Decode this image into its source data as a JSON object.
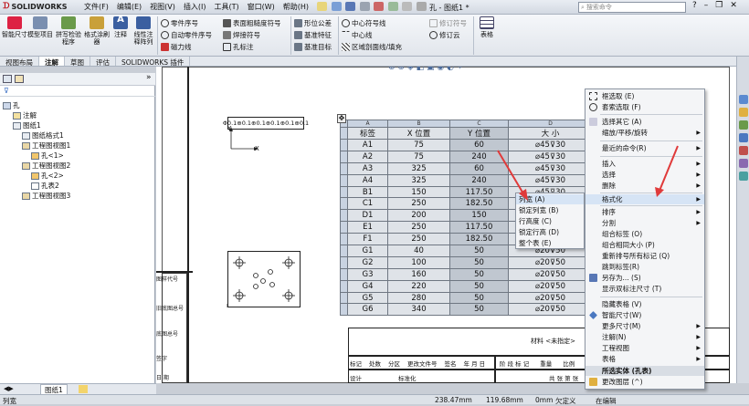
{
  "app": {
    "brand": "SOLIDWORKS",
    "title": "孔 - 图纸1 *",
    "search_placeholder": "搜索命令"
  },
  "menu": [
    "文件(F)",
    "编辑(E)",
    "视图(V)",
    "插入(I)",
    "工具(T)",
    "窗口(W)",
    "帮助(H)"
  ],
  "ribbon": {
    "big": [
      "智能尺寸",
      "模型项目",
      "拼写检验程序",
      "格式涂刷器",
      "注释",
      "线性注释阵列"
    ],
    "small": [
      "零件序号",
      "自动零件序号",
      "磁力线",
      "表面粗糙度符号",
      "焊接符号",
      "孔标注",
      "形位公差",
      "基准特征",
      "基准目标",
      "中心符号线",
      "中心线",
      "区域剖面线/填充",
      "修订符号",
      "修订云"
    ],
    "table": "表格"
  },
  "tabs": [
    "视图布局",
    "注解",
    "草图",
    "评估",
    "SOLIDWORKS 插件"
  ],
  "tree": [
    "孔",
    "注解",
    "图纸1",
    "图纸格式1",
    "工程图视图1",
    "孔<1>",
    "工程图视图2",
    "孔<2>",
    "孔表2",
    "工程图视图3"
  ],
  "sheet_tabs": [
    "图纸1"
  ],
  "drawing": {
    "fcf_top": "Φ0.1⊕0.1⊕0.1⊕0.1⊕0.1⊕0.1",
    "axis_x": "X",
    "axis_y": "Y",
    "title_labels": [
      "图样代号",
      "旧底图总号",
      "底图总号",
      "签字",
      "日 期"
    ],
    "block_labels": [
      "标记",
      "处数",
      "分区",
      "更改文件号",
      "签名",
      "年 月 日",
      "阶 段 标 记",
      "重量",
      "比例",
      "设计",
      "标准化"
    ],
    "mark_name": "材料 <未指定>",
    "sheet_info": "共 张 第 张"
  },
  "hole_table": {
    "col_letters": [
      "A",
      "B",
      "C",
      "D"
    ],
    "headers": [
      "标签",
      "X 位置",
      "Y 位置",
      "大 小"
    ],
    "rows": [
      [
        "A1",
        "75",
        "60",
        "⌀45⊽30"
      ],
      [
        "A2",
        "75",
        "240",
        "⌀45⊽30"
      ],
      [
        "A3",
        "325",
        "60",
        "⌀45⊽30"
      ],
      [
        "A4",
        "325",
        "240",
        "⌀45⊽30"
      ],
      [
        "B1",
        "150",
        "117.50",
        "⌀45⊽30"
      ],
      [
        "C1",
        "250",
        "182.50",
        "⌀45⊽30"
      ],
      [
        "D1",
        "200",
        "150",
        "⌀45⊽30"
      ],
      [
        "E1",
        "250",
        "117.50",
        "⌀45⊽30"
      ],
      [
        "F1",
        "250",
        "182.50",
        "⌀45⊽30"
      ],
      [
        "G1",
        "40",
        "50",
        "⌀20⊽50"
      ],
      [
        "G2",
        "100",
        "50",
        "⌀20⊽50"
      ],
      [
        "G3",
        "160",
        "50",
        "⌀20⊽50"
      ],
      [
        "G4",
        "220",
        "50",
        "⌀20⊽50"
      ],
      [
        "G5",
        "280",
        "50",
        "⌀20⊽50"
      ],
      [
        "G6",
        "340",
        "50",
        "⌀20⊽50"
      ]
    ]
  },
  "context_menu": {
    "items": [
      "框选取 (E)",
      "套索选取 (F)",
      "选择其它 (A)",
      "缩放/平移/旋转",
      "最近的命令(R)",
      "插入",
      "选择",
      "删除",
      "格式化",
      "排序",
      "分割",
      "组合标签 (O)",
      "组合相同大小 (P)",
      "重新排号所有标记 (Q)",
      "跳到标签(R)",
      "另存为... (S)",
      "显示双标注尺寸 (T)",
      "隐藏表格 (V)",
      "智能尺寸(W)",
      "更多尺寸(M)",
      "注解(N)",
      "工程视图",
      "表格",
      "所选实体 (孔表)",
      "更改图层 (^)"
    ],
    "submenu": [
      "列宽 (A)",
      "锁定列宽 (B)",
      "行高度 (C)",
      "锁定行高 (D)",
      "整个表 (E)"
    ]
  },
  "status": {
    "left": "列宽",
    "x": "238.47mm",
    "y": "119.68mm",
    "z": "0mm",
    "state": "欠定义",
    "extra": "在编辑"
  },
  "colors": {
    "arrow": "#e03a3a",
    "highlight": "#d6e4f5",
    "ribbon": "#e2e6ec"
  }
}
